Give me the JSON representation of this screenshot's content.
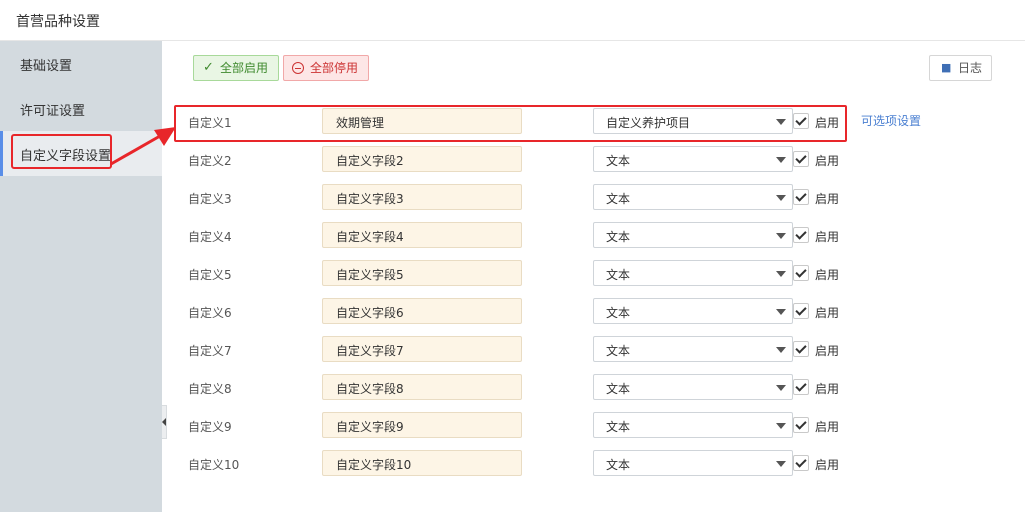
{
  "page": {
    "title": "首营品种设置"
  },
  "sidebar": {
    "items": [
      {
        "label": "基础设置",
        "active": false
      },
      {
        "label": "许可证设置",
        "active": false
      },
      {
        "label": "自定义字段设置",
        "active": true
      }
    ]
  },
  "toolbar": {
    "enable_all_label": "全部启用",
    "disable_all_label": "全部停用",
    "log_label": "日志"
  },
  "option_settings_label": "可选项设置",
  "rows": [
    {
      "label": "自定义1",
      "name": "效期管理",
      "type": "自定义养护项目",
      "enabled_label": "启用",
      "checked": true
    },
    {
      "label": "自定义2",
      "name": "自定义字段2",
      "type": "文本",
      "enabled_label": "启用",
      "checked": true
    },
    {
      "label": "自定义3",
      "name": "自定义字段3",
      "type": "文本",
      "enabled_label": "启用",
      "checked": true
    },
    {
      "label": "自定义4",
      "name": "自定义字段4",
      "type": "文本",
      "enabled_label": "启用",
      "checked": true
    },
    {
      "label": "自定义5",
      "name": "自定义字段5",
      "type": "文本",
      "enabled_label": "启用",
      "checked": true
    },
    {
      "label": "自定义6",
      "name": "自定义字段6",
      "type": "文本",
      "enabled_label": "启用",
      "checked": true
    },
    {
      "label": "自定义7",
      "name": "自定义字段7",
      "type": "文本",
      "enabled_label": "启用",
      "checked": true
    },
    {
      "label": "自定义8",
      "name": "自定义字段8",
      "type": "文本",
      "enabled_label": "启用",
      "checked": true
    },
    {
      "label": "自定义9",
      "name": "自定义字段9",
      "type": "文本",
      "enabled_label": "启用",
      "checked": true
    },
    {
      "label": "自定义10",
      "name": "自定义字段10",
      "type": "文本",
      "enabled_label": "启用",
      "checked": true
    }
  ],
  "icons": {
    "enable": "check-icon",
    "disable": "minus-circle-icon",
    "log": "book-icon",
    "dropdown": "caret-down-icon"
  },
  "colors": {
    "sidebar_bg": "#d3dadf",
    "active_indicator": "#5a8ee8",
    "annotation_red": "#e8262a",
    "link_blue": "#4a7fd1",
    "name_box_bg": "#fdf5e6"
  }
}
